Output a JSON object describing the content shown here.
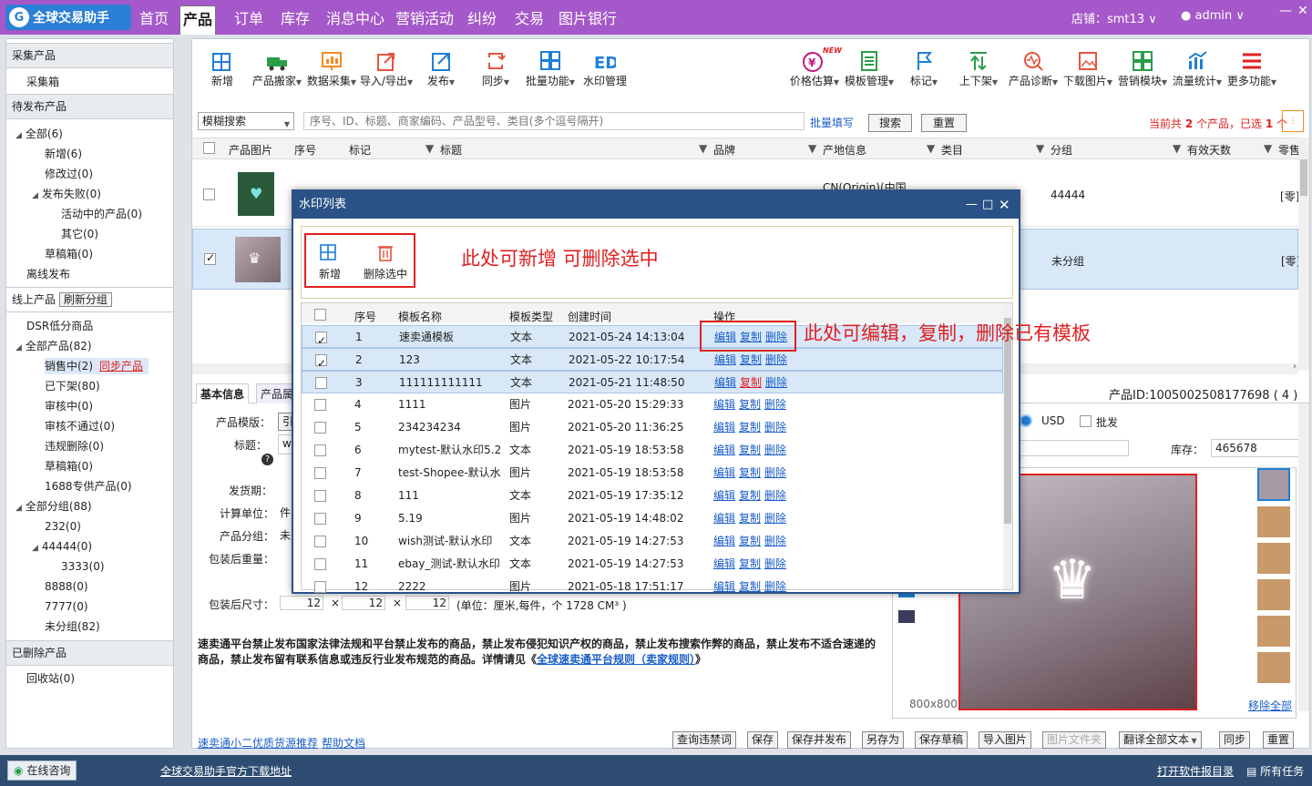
{
  "app": {
    "logo_text": "全球交易助手"
  },
  "nav": {
    "tabs": [
      "首页",
      "产品",
      "订单",
      "库存",
      "消息中心",
      "营销活动",
      "纠纷",
      "交易",
      "图片银行"
    ],
    "active": "产品"
  },
  "top_right": {
    "store": "店铺：smt13",
    "user": "admin"
  },
  "left": {
    "sections": [
      "采集产品",
      "待发布产品",
      "线上产品",
      "已删除产品"
    ],
    "collect_box": "采集箱",
    "pending": [
      "全部(6)",
      "新增(6)",
      "修改过(0)",
      "发布失败(0)",
      "活动中的产品(0)",
      "其它(0)",
      "草稿箱(0)",
      "离线发布"
    ],
    "refresh_group": "刷新分组",
    "online": [
      "DSR低分商品",
      "全部产品(82)",
      "销售中(2)",
      "同步产品",
      "已下架(80)",
      "审核中(0)",
      "审核不通过(0)",
      "违规删除(0)",
      "草稿箱(0)",
      "1688专供产品(0)",
      "全部分组(88)",
      "232(0)",
      "44444(0)",
      "3333(0)",
      "8888(0)",
      "7777(0)",
      "未分组(82)"
    ],
    "recycle": "回收站(0)"
  },
  "toolbar": {
    "left": [
      "新增",
      "产品搬家",
      "数据采集",
      "导入/导出",
      "发布",
      "同步",
      "批量功能",
      "水印管理"
    ],
    "right": [
      "价格估算",
      "模板管理",
      "标记",
      "上下架",
      "产品诊断",
      "下载图片",
      "营销模块",
      "流量统计",
      "更多功能"
    ],
    "new_badge": "NEW"
  },
  "search": {
    "mode": "模糊搜索",
    "placeholder": "序号、ID、标题、商家编码、产品型号、类目(多个逗号隔开)",
    "batch": "批量填写",
    "search_btn": "搜索",
    "reset_btn": "重置",
    "summary_prefix": "当前共",
    "total": "2",
    "summary_mid": "个产品，已选",
    "selected": "1",
    "summary_suffix": "个"
  },
  "table": {
    "headers": [
      "产品图片",
      "序号",
      "标记",
      "标题",
      "品牌",
      "产地信息",
      "类目",
      "分组",
      "有效天数",
      "零售"
    ],
    "rows": [
      {
        "origin": "CN(Origin)(中国",
        "group": "44444",
        "tag": "[零]"
      },
      {
        "origin": "",
        "group": "未分组",
        "tag": "[零]"
      }
    ]
  },
  "detail": {
    "tabs": [
      "基本信息",
      "产品属"
    ],
    "product_id": "产品ID:1005002508177698 ( 4 )",
    "labels": [
      "产品模版：",
      "标题：",
      "发货期：",
      "计算单位：",
      "产品分组：",
      "包装后重量：",
      "包装后尺寸："
    ],
    "template_val": "引",
    "title_val": "w",
    "unit_val": "件",
    "group_val": "未",
    "dims": [
      "12",
      "12",
      "12"
    ],
    "dims_unit": "(单位：厘米,每件，个  1728 CM³ )",
    "currency": "USD",
    "wholesale": "批发",
    "stock_label": "库存：",
    "stock": "465678",
    "img_size": "800x800",
    "remove_all": "移除全部",
    "notice1": "速卖通平台禁止发布国家法律法规和平台禁止发布的商品，禁止发布侵犯知识产权的商品，禁止发布搜索作弊的商品，禁止发布不适合速递的",
    "notice2_a": "商品，禁止发布留有联系信息或违反行业发布规范的商品。详情请见《",
    "notice2_link": "全球速卖通平台规则（卖家规则）",
    "notice2_b": "》"
  },
  "footer": {
    "links": [
      "速卖通小二优质货源推荐",
      "帮助文档"
    ],
    "buttons": [
      "查询违禁词",
      "保存",
      "保存并发布",
      "另存为",
      "保存草稿",
      "导入图片",
      "图片文件夹",
      "翻译全部文本",
      "同步",
      "重置"
    ]
  },
  "dialog": {
    "title": "水印列表",
    "add": "新增",
    "delete_selected": "删除选中",
    "annot1": "此处可新增  可删除选中",
    "annot2": "此处可编辑，复制，删除已有模板",
    "headers": [
      "序号",
      "模板名称",
      "模板类型",
      "创建时间",
      "操作"
    ],
    "ops": [
      "编辑",
      "复制",
      "删除"
    ],
    "rows": [
      {
        "no": "1",
        "name": "速卖通模板",
        "type": "文本",
        "time": "2021-05-24 14:13:04",
        "checked": true
      },
      {
        "no": "2",
        "name": "123",
        "type": "文本",
        "time": "2021-05-22 10:17:54",
        "checked": true
      },
      {
        "no": "3",
        "name": "111111111111",
        "type": "文本",
        "time": "2021-05-21 11:48:50",
        "checked": false
      },
      {
        "no": "4",
        "name": "1111",
        "type": "图片",
        "time": "2021-05-20 15:29:33",
        "checked": false
      },
      {
        "no": "5",
        "name": "234234234",
        "type": "图片",
        "time": "2021-05-20 11:36:25",
        "checked": false
      },
      {
        "no": "6",
        "name": "mytest-默认水印5.2",
        "type": "文本",
        "time": "2021-05-19 18:53:58",
        "checked": false
      },
      {
        "no": "7",
        "name": "test-Shopee-默认水",
        "type": "图片",
        "time": "2021-05-19 18:53:58",
        "checked": false
      },
      {
        "no": "8",
        "name": "111",
        "type": "文本",
        "time": "2021-05-19 17:35:12",
        "checked": false
      },
      {
        "no": "9",
        "name": "5.19",
        "type": "图片",
        "time": "2021-05-19 14:48:02",
        "checked": false
      },
      {
        "no": "10",
        "name": "wish测试-默认水印",
        "type": "文本",
        "time": "2021-05-19 14:27:53",
        "checked": false
      },
      {
        "no": "11",
        "name": "ebay_测试-默认水印",
        "type": "文本",
        "time": "2021-05-19 14:27:53",
        "checked": false
      },
      {
        "no": "12",
        "name": "2222",
        "type": "图片",
        "time": "2021-05-18 17:51:17",
        "checked": false
      }
    ]
  },
  "statusbar": {
    "consult": "在线咨询",
    "download": "全球交易助手官方下载地址",
    "bug": "打开软件报目录",
    "tasks": "所有任务"
  },
  "colors": {
    "topbar": "#a558c9",
    "dialog_header": "#2b5287",
    "annotation": "#e02020",
    "link": "#1a5ec9"
  }
}
